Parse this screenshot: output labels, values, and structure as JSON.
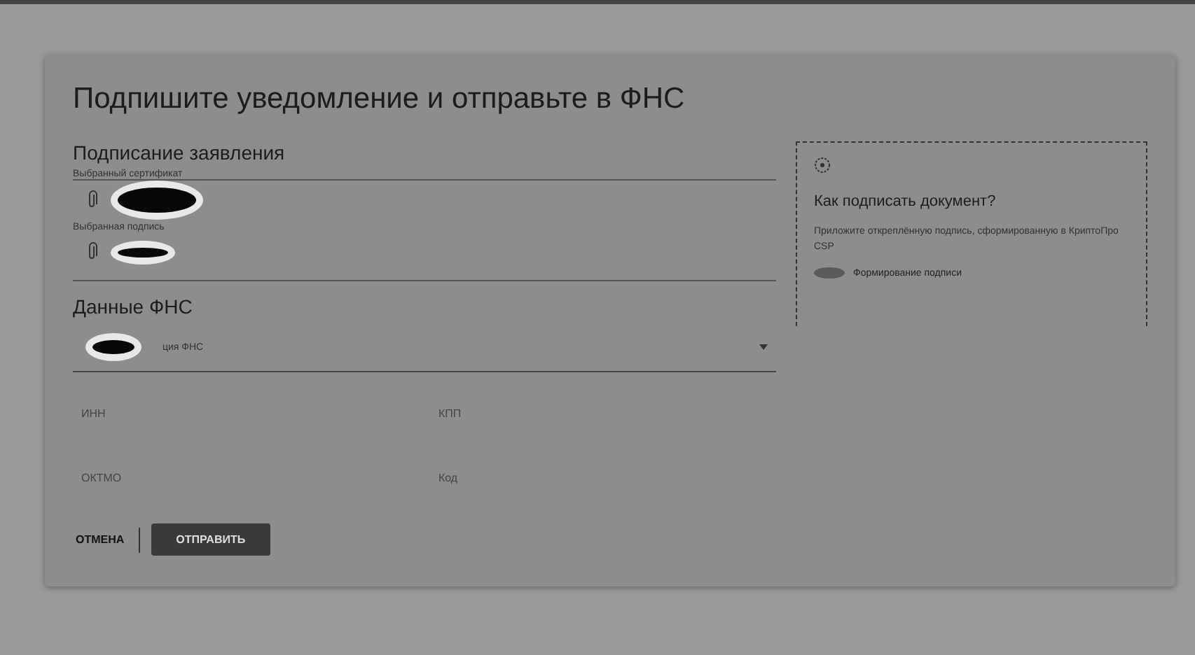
{
  "title": "Подпишите уведомление и отправьте в ФНС",
  "signing": {
    "heading": "Подписание заявления",
    "files": [
      {
        "label": "Выбранный сертификат",
        "redacted": true,
        "kind": "large"
      },
      {
        "label": "Выбранная подпись",
        "redacted": true,
        "kind": "small"
      }
    ]
  },
  "fns": {
    "heading": "Данные ФНС",
    "select": {
      "value": "ция ФНС",
      "redacted": true
    },
    "fields": [
      {
        "placeholder": "ИНН"
      },
      {
        "placeholder": "КПП"
      },
      {
        "placeholder": "ОКТМО"
      },
      {
        "placeholder": "Код"
      }
    ]
  },
  "help": {
    "title": "Как подписать документ?",
    "text": "Приложите откреплённую подпись, сформированную в КриптоПро CSP",
    "link": "Формирование подписи",
    "link_redacted": true
  },
  "buttons": [
    {
      "label": "ОТМЕНА",
      "kind": "text"
    },
    {
      "label": "ОТПРАВИТЬ",
      "kind": "primary"
    }
  ]
}
